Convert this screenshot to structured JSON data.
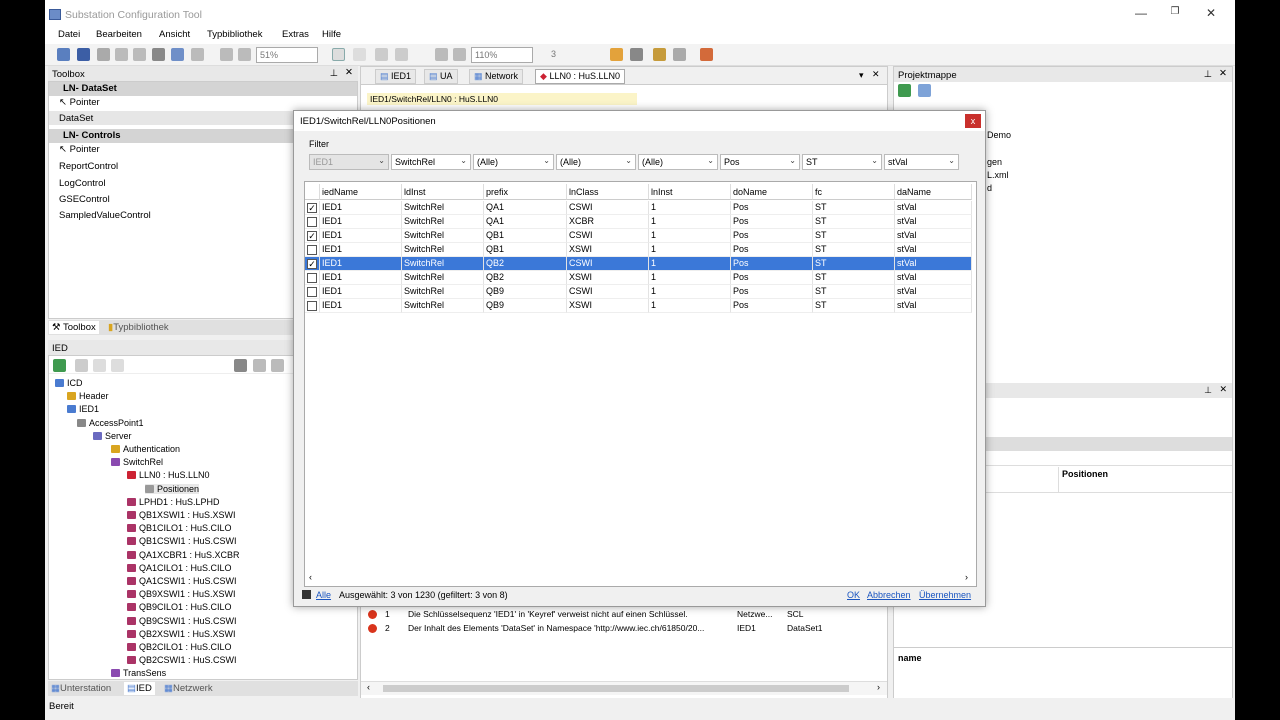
{
  "window": {
    "title": "Substation Configuration Tool",
    "min": "—",
    "max": "❐",
    "close": "✕"
  },
  "menu": [
    "Datei",
    "Bearbeiten",
    "Ansicht",
    "Typbibliothek",
    "Extras",
    "Hilfe"
  ],
  "toolbar": {
    "zoom1": "51%",
    "zoom2": "110%",
    "count": "3"
  },
  "toolbox": {
    "title": "Toolbox",
    "group1": "LN- DataSet",
    "group1_items": [
      "Pointer",
      "DataSet"
    ],
    "group2": "LN- Controls",
    "group2_items": [
      "Pointer",
      "ReportControl",
      "LogControl",
      "GSEControl",
      "SampledValueControl"
    ],
    "tab_toolbox": "Toolbox",
    "tab_typbib": "Typbibliothek"
  },
  "ied_panel": {
    "title": "IED",
    "tree": [
      "ICD",
      "Header",
      "IED1",
      "AccessPoint1",
      "Server",
      "Authentication",
      "SwitchRel",
      "LLN0 : HuS.LLN0",
      "Positionen",
      "LPHD1 : HuS.LPHD",
      "QB1XSWI1 : HuS.XSWI",
      "QB1CILO1 : HuS.CILO",
      "QB1CSWI1 : HuS.CSWI",
      "QA1XCBR1 : HuS.XCBR",
      "QA1CILO1 : HuS.CILO",
      "QA1CSWI1 : HuS.CSWI",
      "QB9XSWI1 : HuS.XSWI",
      "QB9CILO1 : HuS.CILO",
      "QB9CSWI1 : HuS.CSWI",
      "QB2XSWI1 : HuS.XSWI",
      "QB2CILO1 : HuS.CILO",
      "QB2CSWI1 : HuS.CSWI",
      "TransSens"
    ],
    "tabs": [
      "Unterstation",
      "IED",
      "Netzwerk"
    ]
  },
  "center": {
    "tabs": [
      "IED1",
      "UA",
      "Network",
      "LLN0 : HuS.LLN0"
    ],
    "breadcrumb": "IED1/SwitchRel/LLN0 : HuS.LLN0",
    "errors": [
      {
        "num": "1",
        "text": "Die Schlüsselsequenz 'IED1' in 'Keyref' verweist nicht auf einen Schlüssel.",
        "col3": "Netzwe...",
        "col4": "SCL"
      },
      {
        "num": "2",
        "text": "Der Inhalt des Elements 'DataSet' in Namespace 'http://www.iec.ch/61850/20...",
        "col3": "IED1",
        "col4": "DataSet1"
      }
    ]
  },
  "right": {
    "title": "Projektmappe",
    "items": [
      "Demo",
      "gen",
      "L.xml",
      "d"
    ],
    "prop_value": "Positionen",
    "prop_name": "name"
  },
  "dialog": {
    "title": "IED1/SwitchRel/LLN0Positionen",
    "close": "x",
    "filter_label": "Filter",
    "filters": [
      "IED1",
      "SwitchRel",
      "(Alle)",
      "(Alle)",
      "(Alle)",
      "Pos",
      "ST",
      "stVal"
    ],
    "columns": [
      "iedName",
      "ldInst",
      "prefix",
      "lnClass",
      "lnInst",
      "doName",
      "fc",
      "daName"
    ],
    "rows": [
      {
        "checked": true,
        "cells": [
          "IED1",
          "SwitchRel",
          "QA1",
          "CSWI",
          "1",
          "Pos",
          "ST",
          "stVal"
        ]
      },
      {
        "checked": false,
        "cells": [
          "IED1",
          "SwitchRel",
          "QA1",
          "XCBR",
          "1",
          "Pos",
          "ST",
          "stVal"
        ]
      },
      {
        "checked": true,
        "cells": [
          "IED1",
          "SwitchRel",
          "QB1",
          "CSWI",
          "1",
          "Pos",
          "ST",
          "stVal"
        ]
      },
      {
        "checked": false,
        "cells": [
          "IED1",
          "SwitchRel",
          "QB1",
          "XSWI",
          "1",
          "Pos",
          "ST",
          "stVal"
        ]
      },
      {
        "checked": true,
        "selected": true,
        "cells": [
          "IED1",
          "SwitchRel",
          "QB2",
          "CSWI",
          "1",
          "Pos",
          "ST",
          "stVal"
        ]
      },
      {
        "checked": false,
        "cells": [
          "IED1",
          "SwitchRel",
          "QB2",
          "XSWI",
          "1",
          "Pos",
          "ST",
          "stVal"
        ]
      },
      {
        "checked": false,
        "cells": [
          "IED1",
          "SwitchRel",
          "QB9",
          "CSWI",
          "1",
          "Pos",
          "ST",
          "stVal"
        ]
      },
      {
        "checked": false,
        "cells": [
          "IED1",
          "SwitchRel",
          "QB9",
          "XSWI",
          "1",
          "Pos",
          "ST",
          "stVal"
        ]
      }
    ],
    "footer": {
      "alle": "Alle",
      "status": "Ausgewählt: 3 von 1230 (gefiltert: 3 von 8)",
      "ok": "OK",
      "cancel": "Abbrechen",
      "accept": "Übernehmen"
    }
  },
  "statusbar": "Bereit"
}
